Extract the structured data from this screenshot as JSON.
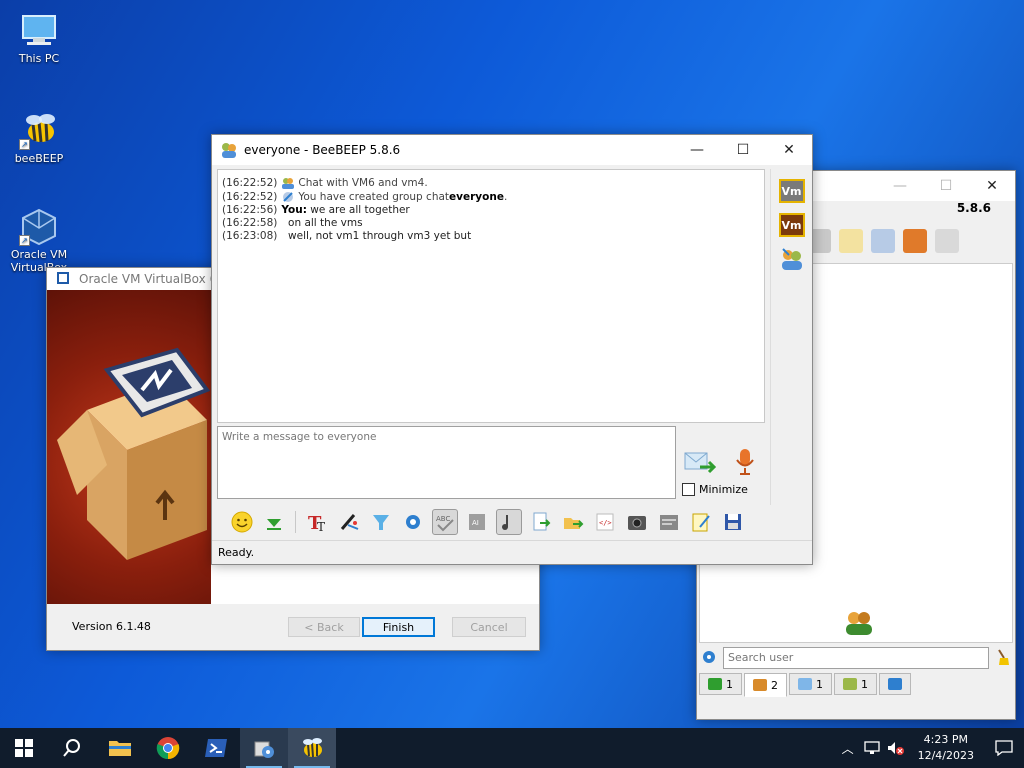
{
  "desktop": {
    "icons": [
      {
        "label": "This PC",
        "icon": "computer-icon"
      },
      {
        "label": "beeBEEP",
        "icon": "bee-icon"
      },
      {
        "label": "Oracle VM VirtualBox",
        "icon": "virtualbox-icon"
      }
    ]
  },
  "virtualbox": {
    "title": "Oracle VM VirtualBox 6.1.48",
    "version_text": "Version 6.1.48",
    "back_label": "< Back",
    "finish_label": "Finish",
    "cancel_label": "Cancel"
  },
  "beebeep_main": {
    "version": "5.8.6",
    "search_placeholder": "Search user",
    "tabs": [
      {
        "icon": "computer-green-icon",
        "count": "1"
      },
      {
        "icon": "users-icon",
        "count": "2"
      },
      {
        "icon": "chat-bubbles-icon",
        "count": "1"
      },
      {
        "icon": "group-icon",
        "count": "1"
      },
      {
        "icon": "flag-icon",
        "count": ""
      }
    ]
  },
  "chat": {
    "title": "everyone - BeeBEEP 5.8.6",
    "messages": [
      {
        "time": "(16:22:52)",
        "kind": "system",
        "pre": "Chat with VM6 and vm4.",
        "bold": "",
        "post": ""
      },
      {
        "time": "(16:22:52)",
        "kind": "system",
        "pre": "You have created group chat ",
        "bold": "everyone",
        "post": "."
      },
      {
        "time": "(16:22:56)",
        "kind": "user",
        "pre": "",
        "bold": "You:",
        "post": " we are all together"
      },
      {
        "time": "(16:22:58)",
        "kind": "cont",
        "pre": "  on all the vms",
        "bold": "",
        "post": ""
      },
      {
        "time": "(16:23:08)",
        "kind": "cont",
        "pre": "  well, not vm1 through vm3 yet but",
        "bold": "",
        "post": ""
      }
    ],
    "input_placeholder": "Write a message to everyone",
    "minimize_label": "Minimize",
    "status": "Ready.",
    "side_badges": [
      "Vm",
      "Vm"
    ]
  },
  "taskbar": {
    "time": "4:23 PM",
    "date": "12/4/2023"
  },
  "colors": {
    "desktop": "#0d5ad8",
    "taskbar": "#101c2c",
    "accent": "#0078d7"
  }
}
